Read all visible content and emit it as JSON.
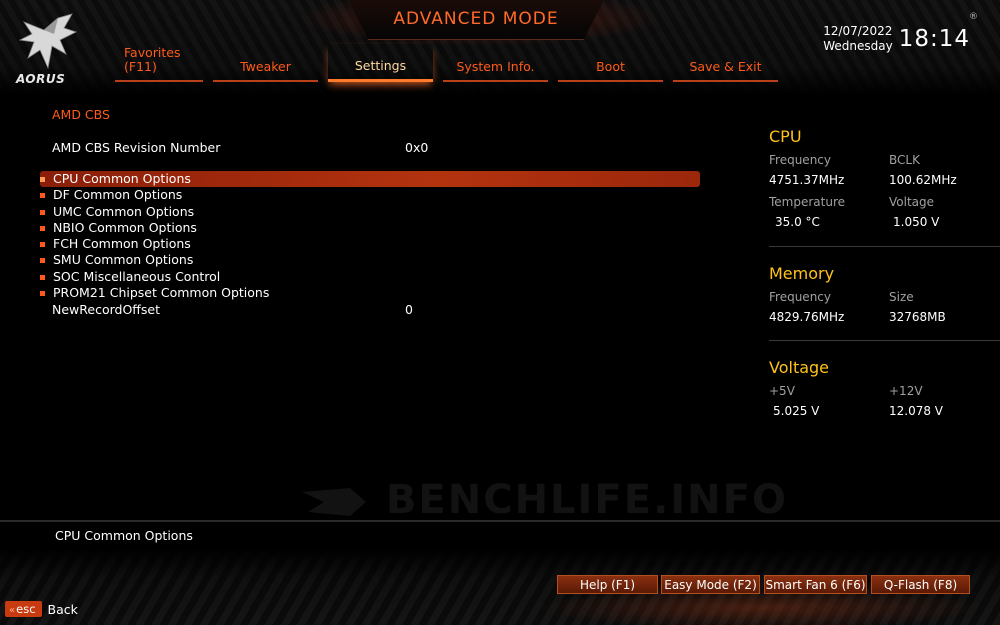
{
  "header": {
    "mode_title": "ADVANCED MODE",
    "logo_text": "AORUS",
    "tabs": [
      {
        "line1": "Favorites",
        "line2": "(F11)"
      },
      {
        "label": "Tweaker"
      },
      {
        "label": "Settings"
      },
      {
        "label": "System Info."
      },
      {
        "label": "Boot"
      },
      {
        "label": "Save & Exit"
      }
    ],
    "active_tab": "Settings",
    "date": "12/07/2022",
    "weekday": "Wednesday",
    "time": "18:14",
    "reg_mark": "®"
  },
  "main": {
    "section_title": "AMD CBS",
    "revision": {
      "label": "AMD CBS Revision Number",
      "value": "0x0"
    },
    "menu_items": [
      "CPU Common Options",
      "DF Common Options",
      "UMC Common Options",
      "NBIO Common Options",
      "FCH Common Options",
      "SMU Common Options",
      "SOC Miscellaneous Control",
      "PROM21 Chipset Common Options"
    ],
    "selected_index": 0,
    "record_offset": {
      "label": "NewRecordOffset",
      "value": "0"
    }
  },
  "panel": {
    "cpu": {
      "title": "CPU",
      "freq_label": "Frequency",
      "freq_value": "4751.37MHz",
      "bclk_label": "BCLK",
      "bclk_value": "100.62MHz",
      "temp_label": "Temperature",
      "temp_value": "35.0 °C",
      "volt_label": "Voltage",
      "volt_value": "1.050 V"
    },
    "memory": {
      "title": "Memory",
      "freq_label": "Frequency",
      "freq_value": "4829.76MHz",
      "size_label": "Size",
      "size_value": "32768MB"
    },
    "voltage": {
      "title": "Voltage",
      "v5_label": "+5V",
      "v5_value": "5.025 V",
      "v12_label": "+12V",
      "v12_value": "12.078 V"
    }
  },
  "watermark": "BENCHLIFE.INFO",
  "help_text": "CPU Common Options",
  "footer": {
    "buttons": [
      "Help (F1)",
      "Easy Mode (F2)",
      "Smart Fan 6 (F6)",
      "Q-Flash (F8)"
    ],
    "esc_label": "esc",
    "back_label": "Back"
  },
  "colors": {
    "accent_orange": "#ff5a1a",
    "panel_title_yellow": "#ffc21a",
    "selection_red": "#b4330f"
  },
  "icons": {
    "logo": "aorus-eagle-icon",
    "esc_chevron": "double-chevron-left-icon"
  }
}
